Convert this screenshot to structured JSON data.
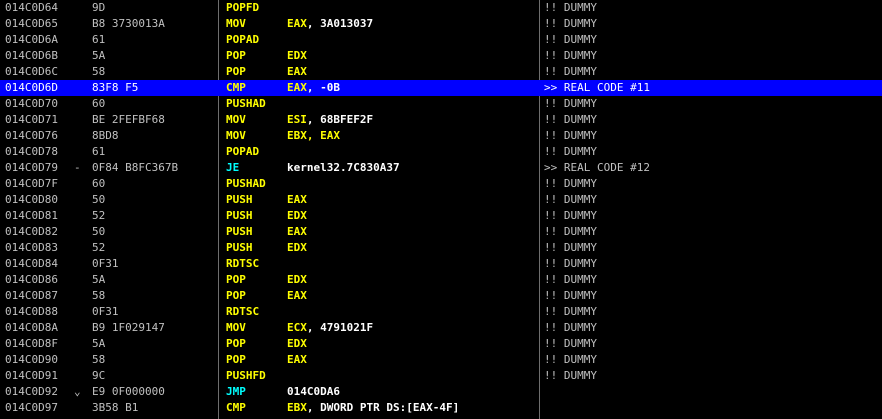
{
  "colors": {
    "background": "#000000",
    "selection": "#0000ff",
    "text": "#c0c0c0",
    "mnemonic": "#ffff00",
    "jump": "#00ffff",
    "register": "#ffff00",
    "value": "#ffffff",
    "separator": "#6e6e6e"
  },
  "rows": [
    {
      "addr": "014C0D64",
      "mark": "",
      "hex": "9D",
      "mn": "POPFD",
      "op": "",
      "op_kind": "value",
      "comment": "!! DUMMY"
    },
    {
      "addr": "014C0D65",
      "mark": "",
      "hex": "B8 3730013A",
      "mn": "MOV",
      "op": "EAX, 3A013037",
      "op_kind": "value",
      "comment": "!! DUMMY"
    },
    {
      "addr": "014C0D6A",
      "mark": "",
      "hex": "61",
      "mn": "POPAD",
      "op": "",
      "op_kind": "value",
      "comment": "!! DUMMY"
    },
    {
      "addr": "014C0D6B",
      "mark": "",
      "hex": "5A",
      "mn": "POP",
      "op": "EDX",
      "op_kind": "reg",
      "comment": "!! DUMMY"
    },
    {
      "addr": "014C0D6C",
      "mark": "",
      "hex": "58",
      "mn": "POP",
      "op": "EAX",
      "op_kind": "reg",
      "comment": "!! DUMMY"
    },
    {
      "addr": "014C0D6D",
      "mark": "",
      "hex": "83F8 F5",
      "mn": "CMP",
      "op": "EAX, -0B",
      "op_kind": "value",
      "comment": ">> REAL CODE #11",
      "selected": true
    },
    {
      "addr": "014C0D70",
      "mark": "",
      "hex": "60",
      "mn": "PUSHAD",
      "op": "",
      "op_kind": "value",
      "comment": "!! DUMMY"
    },
    {
      "addr": "014C0D71",
      "mark": "",
      "hex": "BE 2FEFBF68",
      "mn": "MOV",
      "op": "ESI, 68BFEF2F",
      "op_kind": "value",
      "comment": "!! DUMMY"
    },
    {
      "addr": "014C0D76",
      "mark": "",
      "hex": "8BD8",
      "mn": "MOV",
      "op": "EBX, EAX",
      "op_kind": "reg",
      "comment": "!! DUMMY"
    },
    {
      "addr": "014C0D78",
      "mark": "",
      "hex": "61",
      "mn": "POPAD",
      "op": "",
      "op_kind": "value",
      "comment": "!! DUMMY"
    },
    {
      "addr": "014C0D79",
      "mark": "-",
      "hex": "0F84 B8FC367B",
      "mn": "JE",
      "op": "kernel32.7C830A37",
      "op_kind": "value",
      "comment": ">> REAL CODE #12",
      "jump": true
    },
    {
      "addr": "014C0D7F",
      "mark": "",
      "hex": "60",
      "mn": "PUSHAD",
      "op": "",
      "op_kind": "value",
      "comment": "!! DUMMY"
    },
    {
      "addr": "014C0D80",
      "mark": "",
      "hex": "50",
      "mn": "PUSH",
      "op": "EAX",
      "op_kind": "reg",
      "comment": "!! DUMMY"
    },
    {
      "addr": "014C0D81",
      "mark": "",
      "hex": "52",
      "mn": "PUSH",
      "op": "EDX",
      "op_kind": "reg",
      "comment": "!! DUMMY"
    },
    {
      "addr": "014C0D82",
      "mark": "",
      "hex": "50",
      "mn": "PUSH",
      "op": "EAX",
      "op_kind": "reg",
      "comment": "!! DUMMY"
    },
    {
      "addr": "014C0D83",
      "mark": "",
      "hex": "52",
      "mn": "PUSH",
      "op": "EDX",
      "op_kind": "reg",
      "comment": "!! DUMMY"
    },
    {
      "addr": "014C0D84",
      "mark": "",
      "hex": "0F31",
      "mn": "RDTSC",
      "op": "",
      "op_kind": "value",
      "comment": "!! DUMMY"
    },
    {
      "addr": "014C0D86",
      "mark": "",
      "hex": "5A",
      "mn": "POP",
      "op": "EDX",
      "op_kind": "reg",
      "comment": "!! DUMMY"
    },
    {
      "addr": "014C0D87",
      "mark": "",
      "hex": "58",
      "mn": "POP",
      "op": "EAX",
      "op_kind": "reg",
      "comment": "!! DUMMY"
    },
    {
      "addr": "014C0D88",
      "mark": "",
      "hex": "0F31",
      "mn": "RDTSC",
      "op": "",
      "op_kind": "value",
      "comment": "!! DUMMY"
    },
    {
      "addr": "014C0D8A",
      "mark": "",
      "hex": "B9 1F029147",
      "mn": "MOV",
      "op": "ECX, 4791021F",
      "op_kind": "value",
      "comment": "!! DUMMY"
    },
    {
      "addr": "014C0D8F",
      "mark": "",
      "hex": "5A",
      "mn": "POP",
      "op": "EDX",
      "op_kind": "reg",
      "comment": "!! DUMMY"
    },
    {
      "addr": "014C0D90",
      "mark": "",
      "hex": "58",
      "mn": "POP",
      "op": "EAX",
      "op_kind": "reg",
      "comment": "!! DUMMY"
    },
    {
      "addr": "014C0D91",
      "mark": "",
      "hex": "9C",
      "mn": "PUSHFD",
      "op": "",
      "op_kind": "value",
      "comment": "!! DUMMY"
    },
    {
      "addr": "014C0D92",
      "mark": "⌄",
      "hex": "E9 0F000000",
      "mn": "JMP",
      "op": "014C0DA6",
      "op_kind": "value",
      "comment": "",
      "jump": true
    },
    {
      "addr": "014C0D97",
      "mark": "",
      "hex": "3B58 B1",
      "mn": "CMP",
      "op": "EBX, DWORD PTR DS:[EAX-4F]",
      "op_kind": "value",
      "comment": ""
    }
  ]
}
